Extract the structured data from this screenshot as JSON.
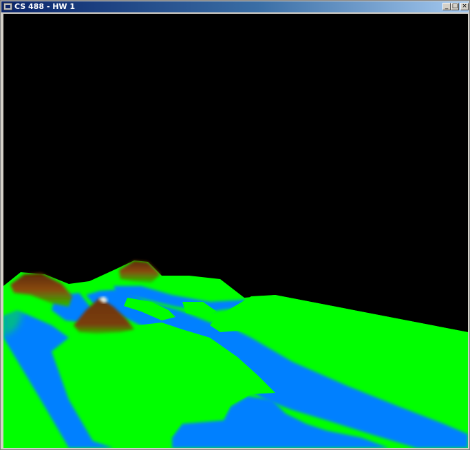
{
  "window": {
    "title": "CS 488 - HW 1",
    "controls": {
      "minimize": "_",
      "maximize": "□",
      "close": "×"
    }
  },
  "icons": [
    "app-icon",
    "minimize-icon",
    "maximize-icon",
    "close-icon"
  ],
  "colors": {
    "background": "#000000",
    "grass": "#00ff00",
    "water": "#0080ff",
    "mountain": "#7a3e0a",
    "titlebar_start": "#0a246a",
    "titlebar_end": "#a6caf0"
  }
}
